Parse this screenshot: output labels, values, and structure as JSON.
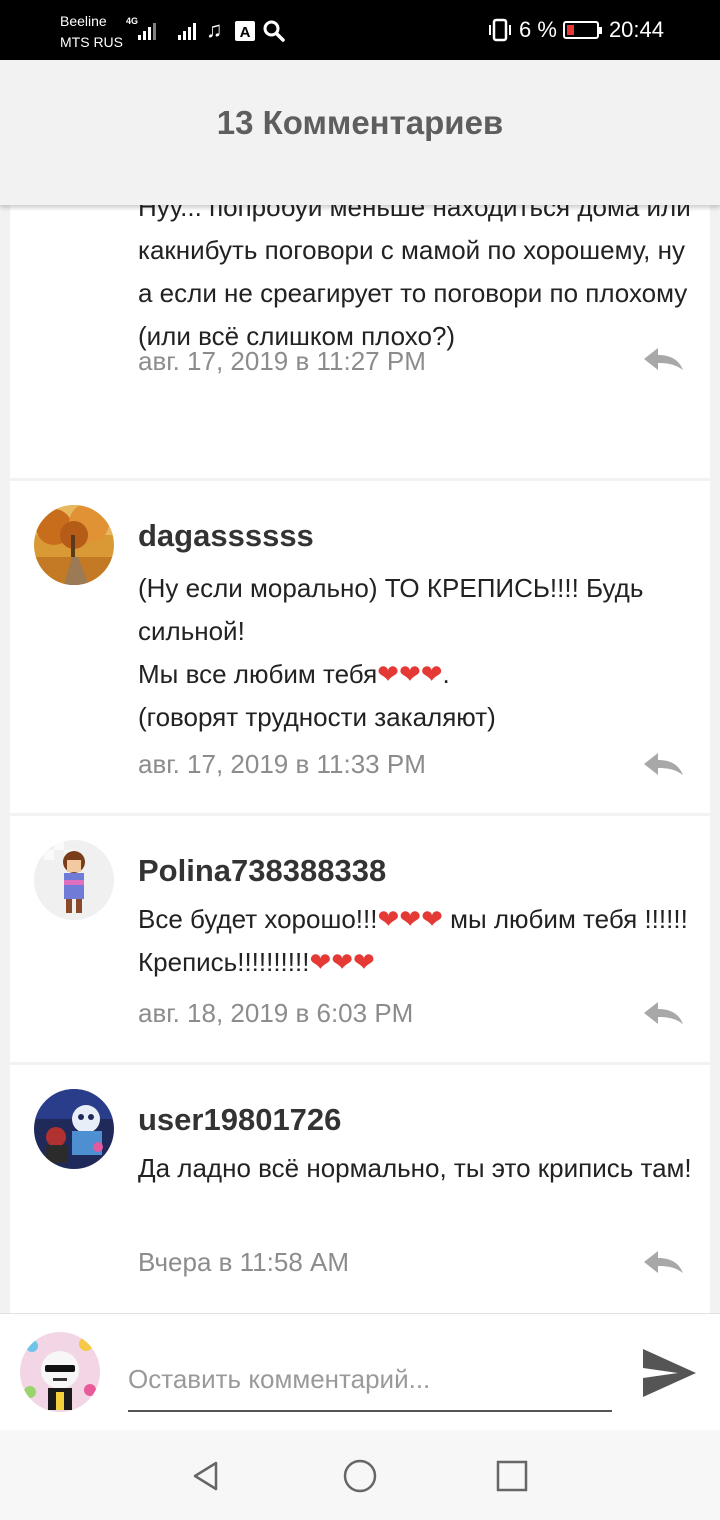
{
  "status_bar": {
    "carrier_1": "Beeline",
    "carrier_2": "MTS RUS",
    "network": "4G",
    "battery": "6 %",
    "time": "20:44"
  },
  "header": {
    "title": "13 Комментариев"
  },
  "comments": [
    {
      "author": "",
      "text": "Нуу... попробуй меньше находиться дома или какнибуть поговори с мамой по хорошему, ну а если не среагирует то поговори по плохому (или всё слишком плохо?)",
      "date": "авг. 17, 2019 в 11:27 PM"
    },
    {
      "author": "dagassssss",
      "text": "(Ну если морально) ТО КРЕПИСЬ!!!! Будь сильной!\nМы все любим тебя❤❤❤.\n(говорят трудности закаляют)",
      "date": "авг. 17, 2019 в 11:33 PM"
    },
    {
      "author": "Polina738388338",
      "text": "Все будет хорошо!!!❤❤❤ мы любим тебя !!!!!! Крепись!!!!!!!!!!❤❤❤",
      "date": "авг. 18, 2019 в 6:03 PM"
    },
    {
      "author": "user19801726",
      "text": "Да ладно всё нормально, ты это крипись там!",
      "date": "Вчера в 11:58 AM"
    }
  ],
  "input": {
    "placeholder": "Оставить комментарий..."
  },
  "icons": {
    "reply": "reply-icon",
    "send": "send-icon",
    "back": "back-icon",
    "home": "home-icon",
    "recents": "recents-icon"
  },
  "colors": {
    "date": "#8c8c8c",
    "header_title": "#5e5e5e",
    "heart": "#e53935"
  }
}
